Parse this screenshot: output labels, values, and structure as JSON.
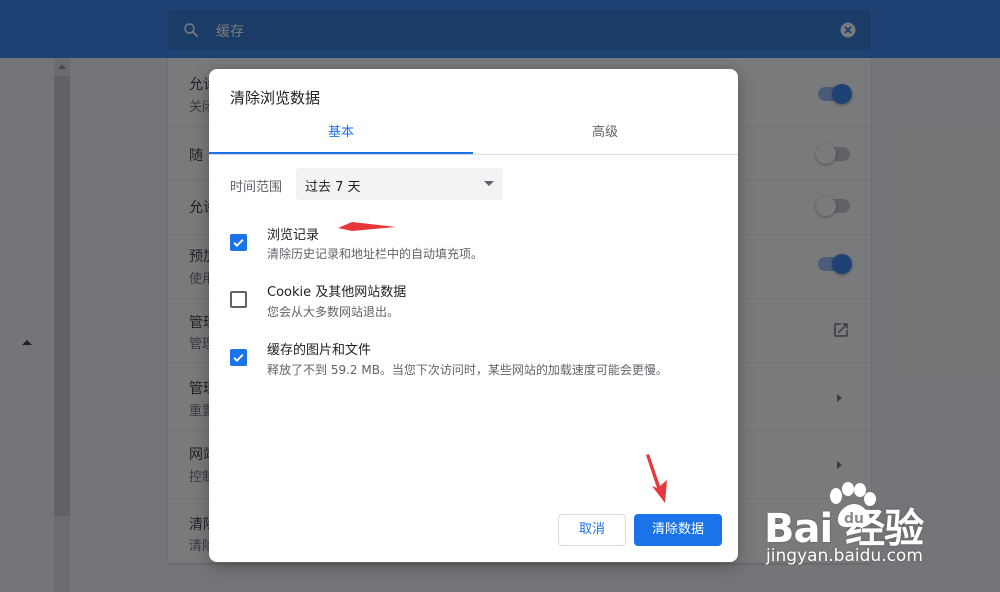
{
  "search": {
    "value": "缓存"
  },
  "settings": {
    "rows": [
      {
        "title": "允许",
        "sub": "关闭",
        "control": "toggle-on"
      },
      {
        "title": "随",
        "control": "toggle-off"
      },
      {
        "title": "允许",
        "control": "toggle-off"
      },
      {
        "title": "预加",
        "sub": "使用",
        "control": "toggle-on"
      },
      {
        "title": "管理",
        "sub": "管理",
        "control": "open-in-new"
      },
      {
        "title": "管理",
        "sub": "重置",
        "control": "chevron"
      },
      {
        "title": "网站",
        "sub": "控制",
        "control": "chevron"
      },
      {
        "title": "清除",
        "sub": "清除",
        "control": "none"
      }
    ]
  },
  "dialog": {
    "title": "清除浏览数据",
    "tabs": {
      "basic": "基本",
      "advanced": "高级",
      "active": "basic"
    },
    "time_range": {
      "label": "时间范围",
      "value": "过去 7 天"
    },
    "items": [
      {
        "title": "浏览记录",
        "desc": "清除历史记录和地址栏中的自动填充项。",
        "checked": true
      },
      {
        "title": "Cookie 及其他网站数据",
        "desc": "您会从大多数网站退出。",
        "checked": false
      },
      {
        "title": "缓存的图片和文件",
        "desc": "释放了不到 59.2 MB。当您下次访问时，某些网站的加载速度可能会更慢。",
        "checked": true
      }
    ],
    "buttons": {
      "cancel": "取消",
      "clear": "清除数据"
    }
  },
  "watermark": {
    "brand": "Bai  经验",
    "url": "jingyan.baidu.com"
  },
  "colors": {
    "accent": "#1a73e8",
    "header": "#1a73e8",
    "annotation_arrow": "#e8363a"
  },
  "icons": [
    "search-icon",
    "clear-search-icon",
    "open-in-new-icon",
    "chevron-right-icon",
    "dropdown-caret-icon",
    "checkmark-icon",
    "baidu-paw-icon"
  ]
}
